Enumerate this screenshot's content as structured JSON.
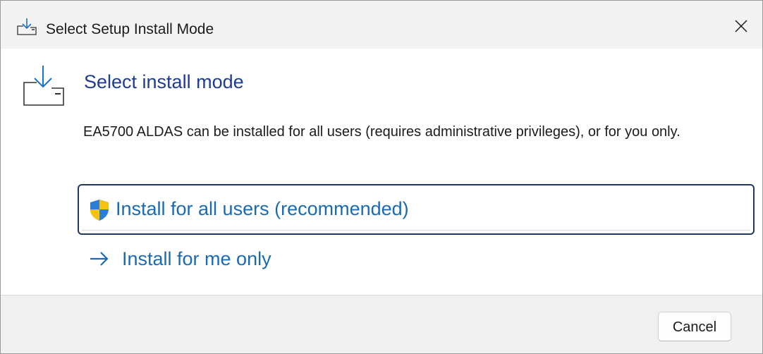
{
  "window": {
    "title": "Select Setup Install Mode",
    "title_icon": "install-download-icon",
    "close_icon": "close-icon"
  },
  "main": {
    "heading": "Select install mode",
    "heading_icon": "install-download-icon",
    "description": "EA5700 ALDAS can be installed for all users (requires administrative privileges), or for you only.",
    "options": [
      {
        "label": "Install for all users (recommended)",
        "icon": "uac-shield-icon",
        "focused": true
      },
      {
        "label": "Install for me only",
        "icon": "arrow-right-icon",
        "focused": false
      }
    ]
  },
  "footer": {
    "cancel_label": "Cancel"
  },
  "colors": {
    "heading": "#1f3c91",
    "link": "#1a6bb2",
    "focus_border": "#1f3864",
    "titlebar_bg": "#f3f3f3",
    "footer_bg": "#f0f0f0",
    "shield_blue": "#2a7ed3",
    "shield_yellow": "#f5c211"
  }
}
